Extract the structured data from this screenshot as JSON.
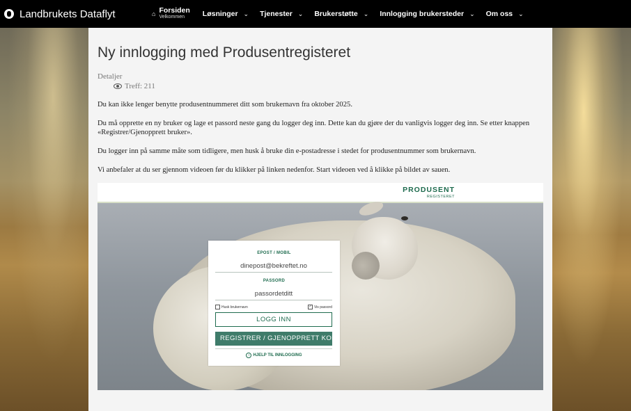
{
  "nav": {
    "brand": "Landbrukets Dataflyt",
    "home": {
      "title": "Forsiden",
      "subtitle": "Velkommen"
    },
    "items": [
      "Løsninger",
      "Tjenester",
      "Brukerstøtte",
      "Innlogging brukersteder",
      "Om oss"
    ]
  },
  "article": {
    "title": "Ny innlogging med Produsentregisteret",
    "details_label": "Detaljer",
    "hits": "Treff: 211",
    "paragraphs": [
      "Du kan ikke lenger benytte produsentnummeret ditt som brukernavn fra oktober 2025.",
      "Du må opprette en ny bruker og lage et passord neste gang du logger deg inn. Dette kan du gjøre der du vanligvis logger deg inn. Se etter knappen «Registrer/Gjenopprett bruker».",
      "Du logger inn på samme måte som tidligere, men husk å bruke din e-postadresse i stedet for produsentnummer som brukernavn.",
      "Vi anbefaler at du ser gjennom videoen før du klikker på linken nedenfor. Start videoen ved å klikke på bildet av sauen."
    ]
  },
  "login_image": {
    "brand_main": "PRODUSENT",
    "brand_sub": "REGISTERET",
    "email_label": "EPOST / MOBIL",
    "email_value": "dinepost@bekreftet.no",
    "password_label": "PASSORD",
    "password_value": "passordetditt",
    "remember_label": "Husk brukernavn",
    "show_password_label": "Vis passord",
    "login_button": "LOGG INN",
    "register_button": "REGISTRER / GJENOPPRETT KONTO",
    "help_link": "HJELP TIL INNLOGGING"
  },
  "colors": {
    "accent": "#1e6b4e",
    "button_dark": "#3f7c6a",
    "nav_bg": "#000000"
  }
}
